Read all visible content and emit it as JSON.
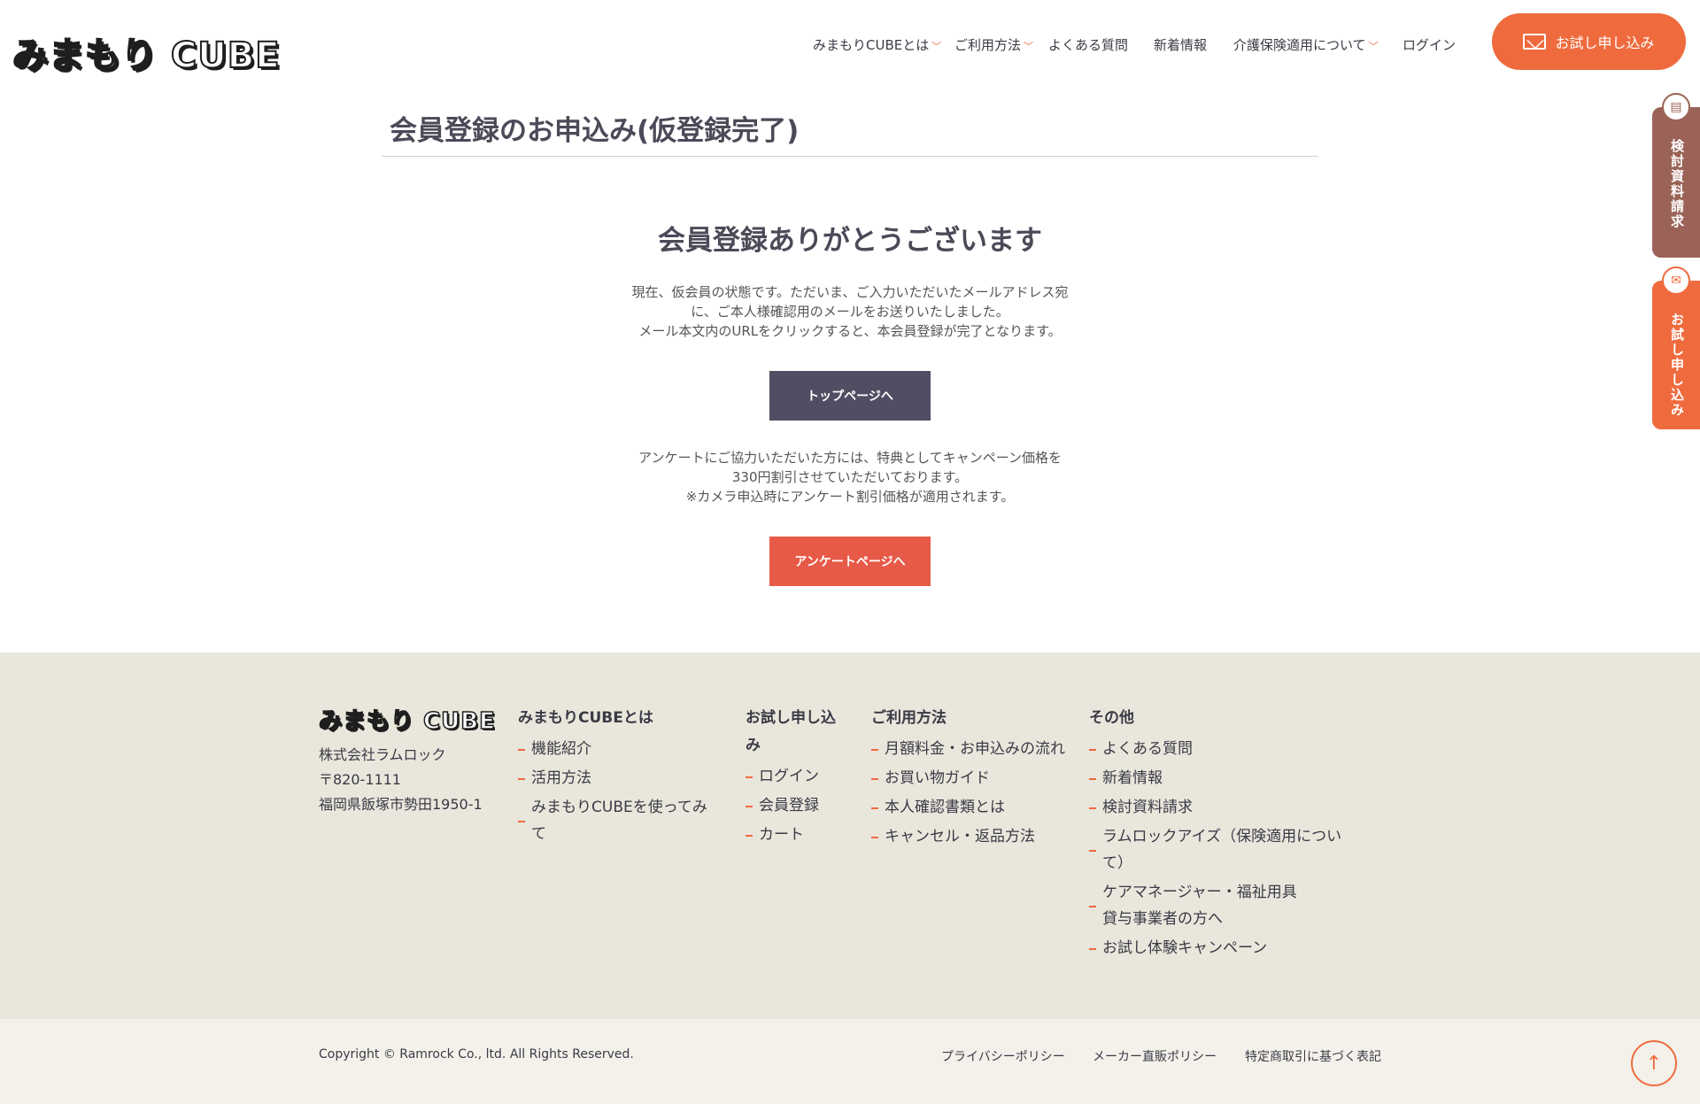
{
  "header": {
    "logo": "みまもり CUBE",
    "nav": [
      {
        "label": "みまもりCUBEとは",
        "has_dropdown": true
      },
      {
        "label": "ご利用方法",
        "has_dropdown": true
      },
      {
        "label": "よくある質問",
        "has_dropdown": false
      },
      {
        "label": "新着情報",
        "has_dropdown": false
      },
      {
        "label": "介護保険適用について",
        "has_dropdown": true
      },
      {
        "label": "ログイン",
        "has_dropdown": false
      }
    ],
    "cta_label": "お試し申し込み",
    "cta_icon": "envelope-icon"
  },
  "side_tabs": {
    "document_request": {
      "label": "検討資料請求",
      "icon": "document-icon",
      "color": "#9b6358"
    },
    "trial": {
      "label": "お試し申し込み",
      "icon": "envelope-icon",
      "color": "#ef6b3e"
    }
  },
  "main": {
    "page_title": "会員登録のお申込み(仮登録完了)",
    "thanks_heading": "会員登録ありがとうございます",
    "message1": [
      "現在、仮会員の状態です。ただいま、ご入力いただいたメールアドレス宛",
      "に、ご本人様確認用のメールをお送りいたしました。",
      "メール本文内のURLをクリックすると、本会員登録が完了となります。"
    ],
    "top_button": "トップページへ",
    "message2": [
      "アンケートにご協力いただいた方には、特典としてキャンペーン価格を",
      "330円割引させていただいております。",
      "※カメラ申込時にアンケート割引価格が適用されます。"
    ],
    "survey_button": "アンケートページへ"
  },
  "footer": {
    "logo": "みまもり CUBE",
    "company": "株式会社ラムロック",
    "postal": "〒820-1111",
    "address": "福岡県飯塚市勢田1950-1",
    "col1": {
      "title": "みまもりCUBEとは",
      "items": [
        "機能紹介",
        "活用方法",
        "みまもりCUBEを使ってみて"
      ]
    },
    "col2": {
      "title": "お試し申し込み",
      "items": [
        "ログイン",
        "会員登録",
        "カート"
      ]
    },
    "col3": {
      "title": "ご利用方法",
      "items": [
        "月額料金・お申込みの流れ",
        "お買い物ガイド",
        "本人確認書類とは",
        "キャンセル・返品方法"
      ]
    },
    "col4": {
      "title": "その他",
      "items": [
        "よくある質問",
        "新着情報",
        "検討資料請求",
        "ラムロックアイズ（保険適用について）",
        "ケアマネージャー・福祉用具貸与事業者の方へ",
        "お試し体験キャンペーン"
      ]
    },
    "copyright": "Copyright © Ramrock Co., ltd. All Rights Reserved.",
    "links": [
      "プライバシーポリシー",
      "メーカー直販ポリシー",
      "特定商取引に基づく表記"
    ],
    "to_top_icon": "arrow-up-icon"
  },
  "colors": {
    "accent": "#ef6b3e",
    "dark_button": "#4f4e63",
    "survey_button": "#e75a48",
    "footer_bg": "#e9e6dc"
  }
}
